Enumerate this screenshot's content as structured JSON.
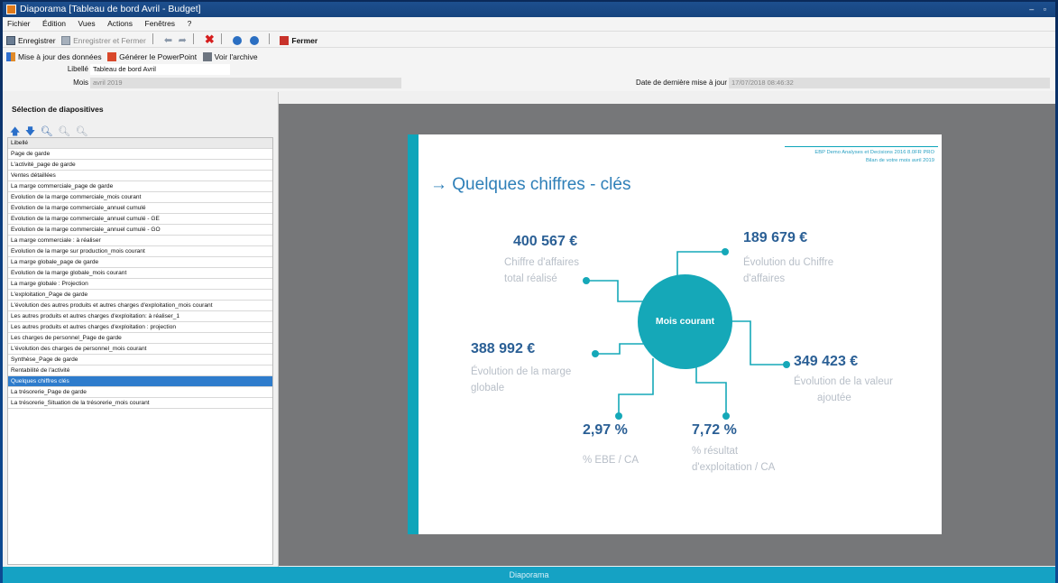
{
  "window": {
    "title": "Diaporama [Tableau de bord Avril - Budget]",
    "controls": "– ▫"
  },
  "menu": [
    "Fichier",
    "Édition",
    "Vues",
    "Actions",
    "Fenêtres",
    "?"
  ],
  "toolbar1": {
    "save": "Enregistrer",
    "save_close": "Enregistrer et Fermer",
    "close": "Fermer"
  },
  "toolbar2": {
    "update": "Mise à jour des données",
    "generate": "Générer le PowerPoint",
    "archive": "Voir l'archive"
  },
  "form": {
    "libelle_label": "Libellé",
    "libelle_value": "Tableau de bord Avril",
    "mois_label": "Mois",
    "mois_value": "avril 2019",
    "date_label": "Date de dernière mise à jour",
    "date_value": "17/07/2018 08:46:32"
  },
  "sidebar": {
    "heading": "Sélection de diapositives",
    "list_header": "Libellé",
    "items": [
      "Page de garde",
      "L'activité_page de garde",
      "Ventes détaillées",
      "La marge commerciale_page de garde",
      "Evolution de la marge commerciale_mois courant",
      "Evolution de la marge commerciale_annuel cumulé",
      "Evolution de la marge commerciale_annuel cumulé - GE",
      "Evolution de la marge commerciale_annuel cumulé - GO",
      "La marge commerciale : à réaliser",
      "Evolution de la marge sur production_mois courant",
      "La marge globale_page de garde",
      "Evolution de la marge globale_mois courant",
      "La marge globale : Projection",
      "L'exploitation_Page de garde",
      "L'évolution des autres produits et  autres charges d'exploitation_mois courant",
      "Les autres produits et autres charges d'exploitation: à réaliser_1",
      "Les autres produits et autres charges d'exploitation : projection",
      "Les charges de personnel_Page de garde",
      "L'évolution des charges de personnel_mois courant",
      "Synthèse_Page de garde",
      "Rentabilité de l'activité",
      "Quelques chiffres clés",
      "La trésorerie_Page de garde",
      "La trésorerie_Situation de la trésorerie_mois courant"
    ],
    "selected_index": 21
  },
  "slide": {
    "meta_line1": "EBP Demo Analyses et Decisions 2016 8.0FR PRO",
    "meta_line2": "Bilan de votre mois avril 2019",
    "title": "→ Quelques chiffres - clés",
    "center": "Mois courant",
    "kpis": [
      {
        "value": "400 567 €",
        "desc1": "Chiffre d'affaires",
        "desc2": "total réalisé"
      },
      {
        "value": "189 679 €",
        "desc1": "Évolution du Chiffre",
        "desc2": "d'affaires"
      },
      {
        "value": "388 992 €",
        "desc1": "Évolution de la marge",
        "desc2": "globale"
      },
      {
        "value": "349 423 €",
        "desc1": "Évolution de la valeur",
        "desc2": "ajoutée"
      },
      {
        "value": "2,97 %",
        "desc1": "% EBE / CA",
        "desc2": ""
      },
      {
        "value": "7,72 %",
        "desc1": "% résultat",
        "desc2": "d'exploitation / CA"
      }
    ]
  },
  "statusbar": "Diaporama",
  "colors": {
    "accent": "#0ea5ba",
    "title": "#2e7fb8",
    "value": "#2a5f95",
    "selection": "#2e7ccc"
  }
}
